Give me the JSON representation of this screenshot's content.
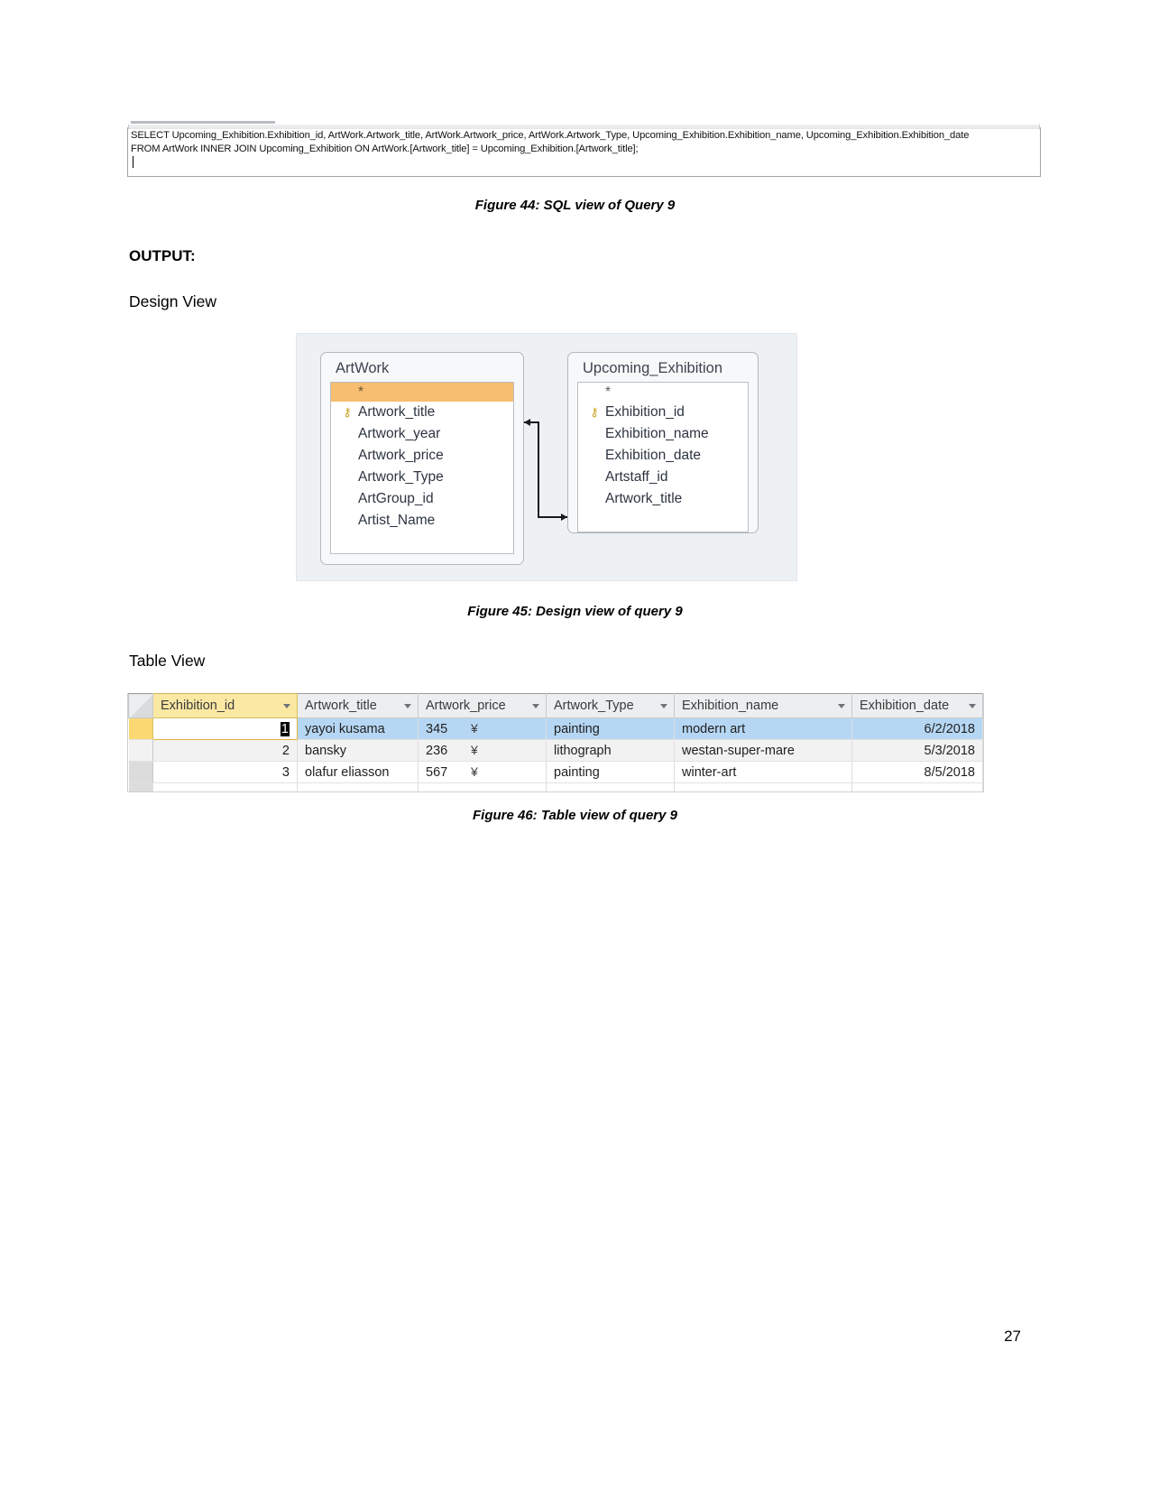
{
  "sql_view": {
    "line1": "SELECT Upcoming_Exhibition.Exhibition_id, ArtWork.Artwork_title, ArtWork.Artwork_price, ArtWork.Artwork_Type, Upcoming_Exhibition.Exhibition_name, Upcoming_Exhibition.Exhibition_date",
    "line2": "FROM ArtWork INNER JOIN Upcoming_Exhibition ON ArtWork.[Artwork_title] = Upcoming_Exhibition.[Artwork_title];"
  },
  "captions": {
    "figure_44": "Figure 44: SQL view of Query 9",
    "figure_45": "Figure 45: Design view of query 9",
    "figure_46": "Figure 46: Table view of query 9"
  },
  "headings": {
    "output": "OUTPUT:",
    "design_view": "Design View",
    "table_view": "Table View"
  },
  "design_view": {
    "tables": [
      {
        "name": "ArtWork",
        "star": "*",
        "fields": [
          {
            "label": "Artwork_title",
            "key": true
          },
          {
            "label": "Artwork_year",
            "key": false
          },
          {
            "label": "Artwork_price",
            "key": false
          },
          {
            "label": "Artwork_Type",
            "key": false
          },
          {
            "label": "ArtGroup_id",
            "key": false
          },
          {
            "label": "Artist_Name",
            "key": false
          }
        ]
      },
      {
        "name": "Upcoming_Exhibition",
        "star": "*",
        "fields": [
          {
            "label": "Exhibition_id",
            "key": true
          },
          {
            "label": "Exhibition_name",
            "key": false
          },
          {
            "label": "Exhibition_date",
            "key": false
          },
          {
            "label": "Artstaff_id",
            "key": false
          },
          {
            "label": "Artwork_title",
            "key": false
          }
        ]
      }
    ],
    "key_glyph": "⚷",
    "highlight_color": "#f7bd70",
    "canvas_color": "#eef1f4"
  },
  "datasheet": {
    "columns": [
      {
        "label": "Exhibition_id",
        "selected": true
      },
      {
        "label": "Artwork_title",
        "selected": false
      },
      {
        "label": "Artwork_price",
        "selected": false
      },
      {
        "label": "Artwork_Type",
        "selected": false
      },
      {
        "label": "Exhibition_name",
        "selected": false
      },
      {
        "label": "Exhibition_date",
        "selected": false
      }
    ],
    "rows": [
      {
        "selected": true,
        "exhibition_id": "1",
        "artwork_title": "yayoi kusama",
        "artwork_price": "345",
        "price_symbol": "¥",
        "artwork_type": "painting",
        "exhibition_name": "modern art",
        "exhibition_date": "6/2/2018"
      },
      {
        "selected": false,
        "exhibition_id": "2",
        "artwork_title": "bansky",
        "artwork_price": "236",
        "price_symbol": "¥",
        "artwork_type": "lithograph",
        "exhibition_name": "westan-super-mare",
        "exhibition_date": "5/3/2018"
      },
      {
        "selected": false,
        "exhibition_id": "3",
        "artwork_title": "olafur eliasson",
        "artwork_price": "567",
        "price_symbol": "¥",
        "artwork_type": "painting",
        "exhibition_name": "winter-art",
        "exhibition_date": "8/5/2018"
      }
    ],
    "selection_color": "#b6d7f4",
    "header_selected_color": "#fbe8a3"
  },
  "page_number": "27"
}
